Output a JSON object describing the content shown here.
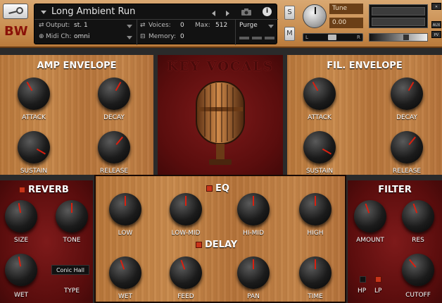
{
  "header": {
    "logo": "BW",
    "instrument_name": "Long Ambient Run",
    "output_label": "Output:",
    "output_value": "st. 1",
    "midi_label": "Midi Ch:",
    "midi_value": "omni",
    "voices_label": "Voices:",
    "voices_value": "0",
    "max_label": "Max:",
    "max_value": "512",
    "memory_label": "Memory:",
    "memory_value": "0",
    "purge_label": "Purge",
    "solo_label": "S",
    "mute_label": "M",
    "tune_label": "Tune",
    "tune_value": "0.00",
    "pan_left": "L",
    "pan_right": "R",
    "aux_label": "AUX",
    "pv_label": "PV"
  },
  "amp_envelope": {
    "title": "AMP ENVELOPE",
    "knobs": [
      {
        "label": "ATTACK",
        "angle": -30
      },
      {
        "label": "DECAY",
        "angle": 30
      },
      {
        "label": "SUSTAIN",
        "angle": 120
      },
      {
        "label": "RELEASE",
        "angle": 40
      }
    ]
  },
  "center": {
    "logo_text": "KEY VOCALS"
  },
  "fil_envelope": {
    "title": "FIL. ENVELOPE",
    "knobs": [
      {
        "label": "ATTACK",
        "angle": -30
      },
      {
        "label": "DECAY",
        "angle": 30
      },
      {
        "label": "SUSTAIN",
        "angle": 120
      },
      {
        "label": "RELEASE",
        "angle": 40
      }
    ]
  },
  "reverb": {
    "title": "REVERB",
    "type_value": "Conic Hall",
    "knobs": [
      {
        "label": "SIZE",
        "angle": -10
      },
      {
        "label": "TONE",
        "angle": 0
      },
      {
        "label": "WET",
        "angle": -10
      },
      {
        "label": "TYPE",
        "angle": 0
      }
    ]
  },
  "eq": {
    "title": "EQ",
    "knobs": [
      {
        "label": "LOW",
        "angle": 0
      },
      {
        "label": "LOW-MID",
        "angle": 0
      },
      {
        "label": "HI-MID",
        "angle": 0
      },
      {
        "label": "HIGH",
        "angle": 0
      }
    ]
  },
  "delay": {
    "title": "DELAY",
    "knobs": [
      {
        "label": "WET",
        "angle": -20
      },
      {
        "label": "FEED",
        "angle": -20
      },
      {
        "label": "PAN",
        "angle": 0
      },
      {
        "label": "TIME",
        "angle": 0
      }
    ]
  },
  "filter": {
    "title": "FILTER",
    "knobs": [
      {
        "label": "AMOUNT",
        "angle": -20
      },
      {
        "label": "RES",
        "angle": -20
      },
      {
        "label": "CUTOFF",
        "angle": -40
      }
    ],
    "hp_label": "HP",
    "lp_label": "LP"
  },
  "colors": {
    "accent": "#d82010",
    "led_on": "#c8341a",
    "wood": "#c48448",
    "panel_red": "#6a1212"
  }
}
